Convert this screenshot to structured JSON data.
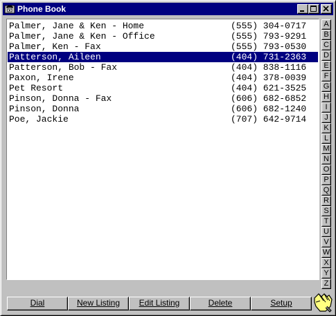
{
  "window": {
    "title": "Phone Book"
  },
  "listings": [
    {
      "name": "Palmer, Jane & Ken - Home",
      "phone": "(555) 304-0717"
    },
    {
      "name": "Palmer, Jane & Ken - Office",
      "phone": "(555) 793-9291"
    },
    {
      "name": "Palmer, Ken - Fax",
      "phone": "(555) 793-0530"
    },
    {
      "name": "Patterson, Aileen",
      "phone": "(404) 731-2363",
      "selected": true
    },
    {
      "name": "Patterson, Bob - Fax",
      "phone": "(404) 838-1116"
    },
    {
      "name": "Paxon, Irene",
      "phone": "(404) 378-0039"
    },
    {
      "name": "Pet Resort",
      "phone": "(404) 621-3525"
    },
    {
      "name": "Pinson, Donna - Fax",
      "phone": "(606) 682-6852"
    },
    {
      "name": "Pinson, Donna",
      "phone": "(606) 682-1240"
    },
    {
      "name": "Poe, Jackie",
      "phone": "(707) 642-9714"
    }
  ],
  "alphabet": [
    "A",
    "B",
    "C",
    "D",
    "E",
    "F",
    "G",
    "H",
    "I",
    "J",
    "K",
    "L",
    "M",
    "N",
    "O",
    "P",
    "Q",
    "R",
    "S",
    "T",
    "U",
    "V",
    "W",
    "X",
    "Y",
    "Z"
  ],
  "buttons": {
    "dial": "Dial",
    "new_listing": "New Listing",
    "edit_listing": "Edit Listing",
    "delete": "Delete",
    "setup": "Setup"
  },
  "icons": {
    "app": "phone-book-icon",
    "corner": "pointing-hand-icon"
  },
  "colors": {
    "titlebar": "#000080",
    "selection": "#000080",
    "face": "#c0c0c0"
  }
}
